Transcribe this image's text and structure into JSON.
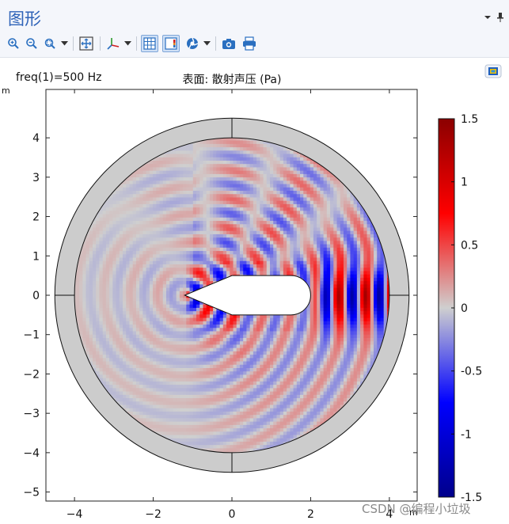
{
  "window": {
    "title": "图形",
    "menu_icon": "chevron-down-icon",
    "pin_icon": "pin-icon"
  },
  "toolbar": {
    "buttons": [
      {
        "name": "zoom-in-icon",
        "active": false
      },
      {
        "name": "zoom-out-icon",
        "active": false
      },
      {
        "name": "zoom-box-icon",
        "active": false,
        "dropdown": true
      },
      {
        "name": "zoom-extents-icon",
        "active": false
      },
      {
        "name": "axis-orientation-icon",
        "active": false,
        "dropdown": true
      },
      {
        "name": "grid-toggle-icon",
        "active": true
      },
      {
        "name": "legend-toggle-icon",
        "active": true
      },
      {
        "name": "scene-light-icon",
        "active": false,
        "dropdown": true
      },
      {
        "name": "camera-icon",
        "active": false
      },
      {
        "name": "print-icon",
        "active": false
      }
    ]
  },
  "plot": {
    "freq_label": "freq(1)=500 Hz",
    "title": "表面: 散射声压 (Pa)",
    "unit_x": "m",
    "unit_y": "m",
    "colors": {
      "high": "#8b0000",
      "mid": "#cfcfcf",
      "low": "#00008b",
      "pml": "#cccccc"
    }
  },
  "chart_data": {
    "type": "heatmap",
    "title": "表面: 散射声压 (Pa)",
    "subtitle": "freq(1)=500 Hz",
    "xlabel": "m",
    "ylabel": "m",
    "xlim": [
      -4.8,
      4.7
    ],
    "ylim": [
      -5.2,
      5.2
    ],
    "xticks": [
      -4,
      -2,
      0,
      2,
      4
    ],
    "yticks": [
      -5,
      -4,
      -3,
      -2,
      -1,
      0,
      1,
      2,
      3,
      4
    ],
    "colorbar": {
      "range": [
        -1.5,
        1.5
      ],
      "ticks": [
        "1.5",
        "1",
        "0.5",
        "0",
        "-0.5",
        "-1",
        "-1.5"
      ],
      "colormap": "wave (dark blue - blue - grey - red - dark red)"
    },
    "domain": {
      "inner_radius": 4,
      "outer_radius": 4.5,
      "outer_layer": "PML (grey)"
    },
    "obstacle": {
      "description": "white wedge-shaped body pointing in -x direction",
      "tip_x": -1.2,
      "tail_x": 2,
      "half_height": 0.5
    },
    "field": {
      "wavenumber_rad_per_m": 9.2,
      "peak_region": "x from 2 to 4, y near 0"
    }
  },
  "watermark": "CSDN @编程小垃圾"
}
